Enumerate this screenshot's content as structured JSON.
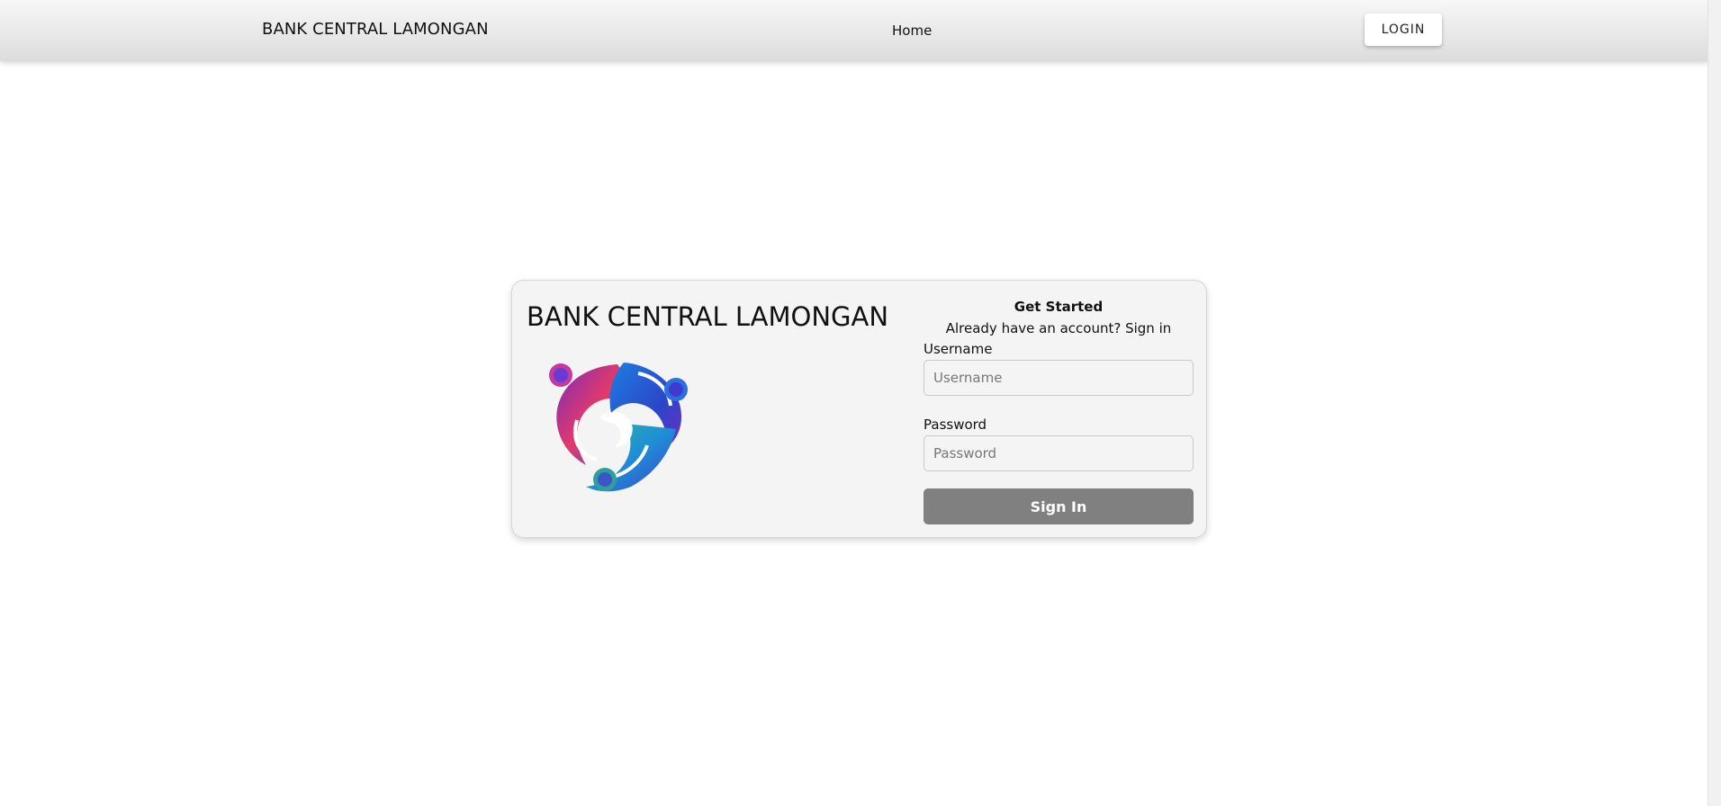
{
  "navbar": {
    "brand": "BANK CENTRAL LAMONGAN",
    "home_link": "Home",
    "login_button": "LOGIN"
  },
  "card": {
    "title": "BANK CENTRAL LAMONGAN",
    "logo_icon": "swirl-logo-icon"
  },
  "form": {
    "heading": "Get Started",
    "signin_prompt": "Already have an account? Sign in",
    "username_label": "Username",
    "username_placeholder": "Username",
    "username_value": "",
    "password_label": "Password",
    "password_placeholder": "Password",
    "password_value": "",
    "submit_label": "Sign In"
  },
  "colors": {
    "navbar_bg": "#e4e4e4",
    "card_bg": "#f4f4f4",
    "submit_bg": "#808080"
  }
}
